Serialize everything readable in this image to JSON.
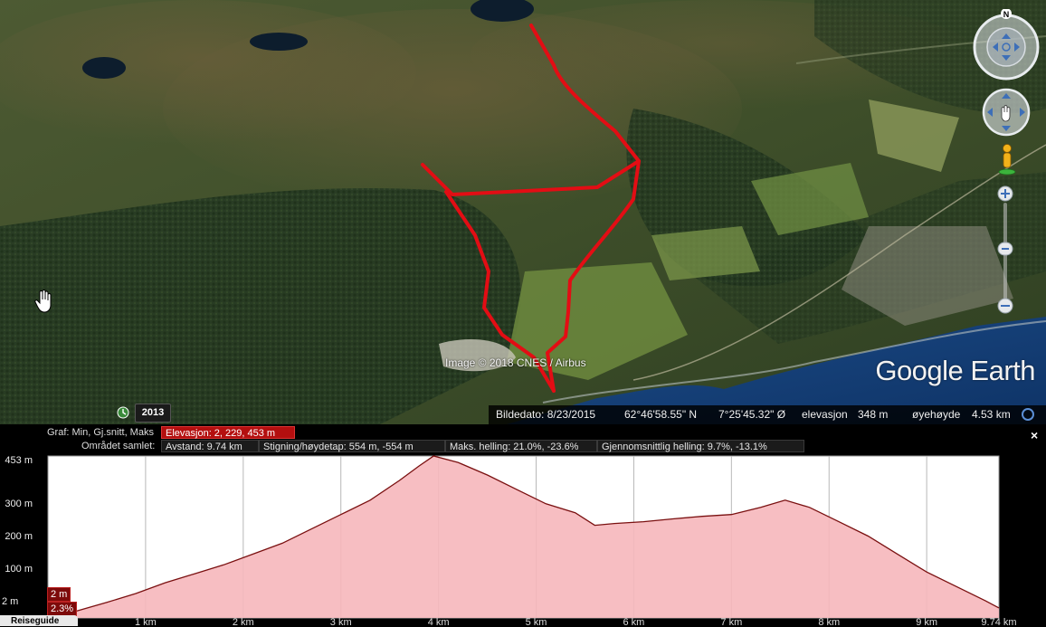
{
  "map": {
    "watermark": "Google Earth",
    "copyright": "Image © 2018 CNES / Airbus",
    "historical_year": "2013",
    "status": {
      "image_date": "Bildedato: 8/23/2015",
      "latitude": "62°46'58.55\" N",
      "longitude": "7°25'45.32\" Ø",
      "elevation_label": "elevasjon",
      "elevation_value": "348 m",
      "eye_alt_label": "øyehøyde",
      "eye_alt_value": "4.53 km"
    },
    "compass_label": "N",
    "icons": [
      "hand-cursor-icon",
      "clock-icon",
      "compass-ring-icon",
      "pan-icon",
      "pegman-icon",
      "zoom-plus-icon",
      "zoom-minus-icon",
      "status-circle-icon"
    ]
  },
  "profile": {
    "graph_label": "Graf: Min, Gj.snitt, Maks",
    "elevation_cell": "Elevasjon: 2, 229, 453 m",
    "area_label": "Området samlet:",
    "distance_cell": "Avstand: 9.74 km",
    "climb_cell": "Stigning/høydetap: 554 m, -554 m",
    "max_slope_cell": "Maks. helling: 21.0%, -23.6%",
    "avg_slope_cell": "Gjennomsnittlig helling: 9.7%, -13.1%",
    "close_label": "×",
    "min_elevation_box": "2 m",
    "min_slope_box": "2.3%",
    "travel_guide": "Reiseguide"
  },
  "chart_data": {
    "type": "area",
    "y_ticks": [
      "453 m",
      "300 m",
      "200 m",
      "100 m",
      "2 m"
    ],
    "x_ticks": [
      "1 km",
      "2 km",
      "3 km",
      "4 km",
      "5 km",
      "6 km",
      "7 km",
      "8 km",
      "9 km",
      "9.74 km"
    ],
    "ylim": [
      2,
      453
    ],
    "xlim": [
      0,
      9.74
    ],
    "x": [
      0,
      0.3,
      0.6,
      0.9,
      1.2,
      1.5,
      1.8,
      2.1,
      2.4,
      2.7,
      3.0,
      3.3,
      3.6,
      3.8,
      3.95,
      4.2,
      4.5,
      4.8,
      5.1,
      5.4,
      5.6,
      5.8,
      6.1,
      6.4,
      6.7,
      7.0,
      7.3,
      7.55,
      7.8,
      8.1,
      8.4,
      8.7,
      9.0,
      9.3,
      9.6,
      9.74
    ],
    "series": [
      {
        "values": [
          10,
          22,
          45,
          70,
          100,
          125,
          150,
          180,
          210,
          250,
          290,
          330,
          385,
          425,
          453,
          435,
          400,
          360,
          320,
          295,
          260,
          265,
          270,
          278,
          285,
          290,
          310,
          330,
          310,
          270,
          230,
          180,
          130,
          90,
          50,
          30
        ]
      }
    ],
    "fill_color": "#f6b7bb",
    "line_color": "#7a1010",
    "grid": true
  }
}
